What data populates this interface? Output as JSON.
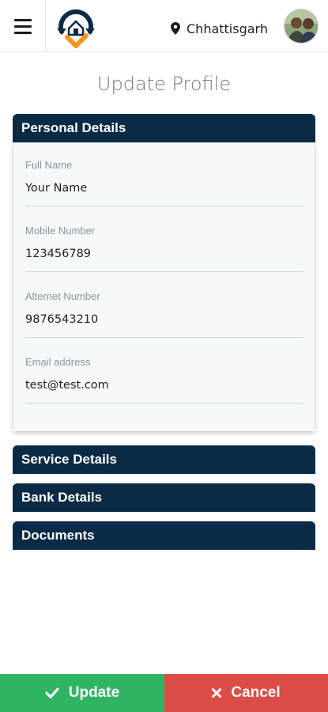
{
  "header": {
    "location": "Chhattisgarh",
    "icons": {
      "menu": "hamburger-menu-icon",
      "location": "map-pin-icon",
      "logo": "home-logo",
      "avatar": "user-avatar"
    }
  },
  "page": {
    "title": "Update Profile"
  },
  "sections": {
    "personal": "Personal Details",
    "service": "Service Details",
    "bank": "Bank Details",
    "documents": "Documents"
  },
  "fields": [
    {
      "label": "Full Name",
      "value": "Your Name"
    },
    {
      "label": "Mobile Number",
      "value": "123456789"
    },
    {
      "label": "Alternet Number",
      "value": "9876543210"
    },
    {
      "label": "Email address",
      "value": "test@test.com"
    }
  ],
  "actions": {
    "update": "Update",
    "cancel": "Cancel"
  },
  "colors": {
    "navy": "#0b2a45",
    "accent_orange": "#f7931e",
    "update_green": "#2fb462",
    "cancel_red": "#dc4d47"
  }
}
